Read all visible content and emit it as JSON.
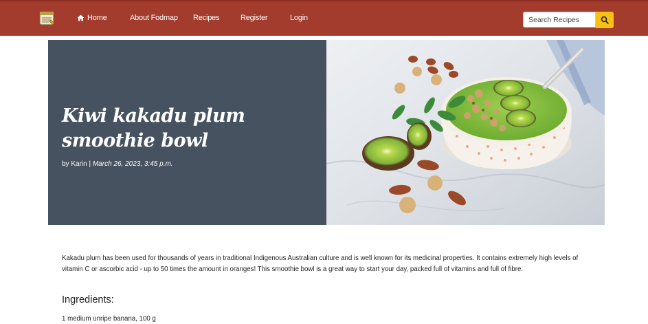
{
  "nav": {
    "home": "Home",
    "about": "About Fodmap",
    "recipes": "Recipes",
    "register": "Register",
    "login": "Login",
    "search_placeholder": "Search Recipes"
  },
  "colors": {
    "navbar": "#a33c2d",
    "hero_panel": "#475261",
    "search_button": "#f6c017"
  },
  "icons": {
    "logo": "recipe-card-icon",
    "home": "home-icon",
    "search": "search-icon"
  },
  "recipe": {
    "title": "Kiwi kakadu plum smoothie bowl",
    "by": "by Karin |",
    "date": "March 26, 2023, 3:45 p.m.",
    "image_subject": "smoothie bowl with kiwi, granola and nuts",
    "intro": "Kakadu plum has been used for thousands of years in traditional Indigenous Australian culture and is well known for its medicinal properties. It contains extremely high levels of vitamin C or ascorbic acid - up to 50 times the amount in oranges! This smoothie bowl is a great way to start your day, packed full of vitamins and full of fibre.",
    "ingredients_heading": "Ingredients:",
    "ingredients": [
      "1 medium unripe banana, 100 g"
    ]
  }
}
